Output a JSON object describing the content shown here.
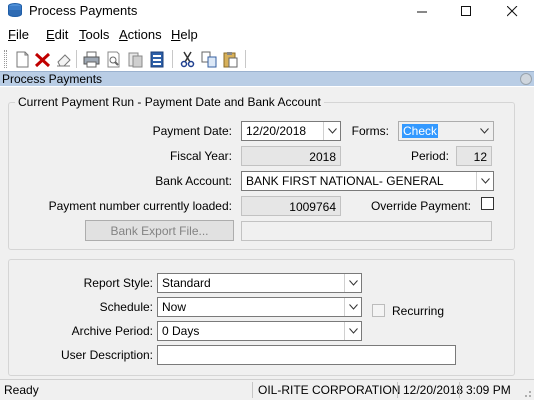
{
  "window": {
    "title": "Process Payments"
  },
  "menu": [
    {
      "key": "F",
      "rest": "ile"
    },
    {
      "key": "E",
      "rest": "dit"
    },
    {
      "key": "T",
      "rest": "ools"
    },
    {
      "key": "A",
      "rest": "ctions"
    },
    {
      "key": "H",
      "rest": "elp"
    }
  ],
  "section": {
    "title": "Process Payments"
  },
  "current_run": {
    "legend": "Current Payment Run - Payment Date and Bank Account",
    "payment_date_label": "Payment Date:",
    "payment_date_value": "12/20/2018",
    "forms_label": "Forms:",
    "forms_value": "Check",
    "fiscal_year_label": "Fiscal Year:",
    "fiscal_year_value": "2018",
    "period_label": "Period:",
    "period_value": "12",
    "bank_account_label": "Bank Account:",
    "bank_account_value": "BANK FIRST NATIONAL- GENERAL",
    "payment_number_label": "Payment number currently loaded:",
    "payment_number_value": "1009764",
    "override_label": "Override Payment:",
    "override_checked": false,
    "bank_export_button": "Bank Export File...",
    "bank_export_path": ""
  },
  "report": {
    "report_style_label": "Report Style:",
    "report_style_value": "Standard",
    "schedule_label": "Schedule:",
    "schedule_value": "Now",
    "recurring_label": "Recurring",
    "recurring_checked": false,
    "archive_period_label": "Archive Period:",
    "archive_period_value": "0 Days",
    "user_description_label": "User Description:",
    "user_description_value": ""
  },
  "status": {
    "state": "Ready",
    "company": "OIL-RITE CORPORATION",
    "date": "12/20/2018",
    "time": "3:09 PM"
  }
}
